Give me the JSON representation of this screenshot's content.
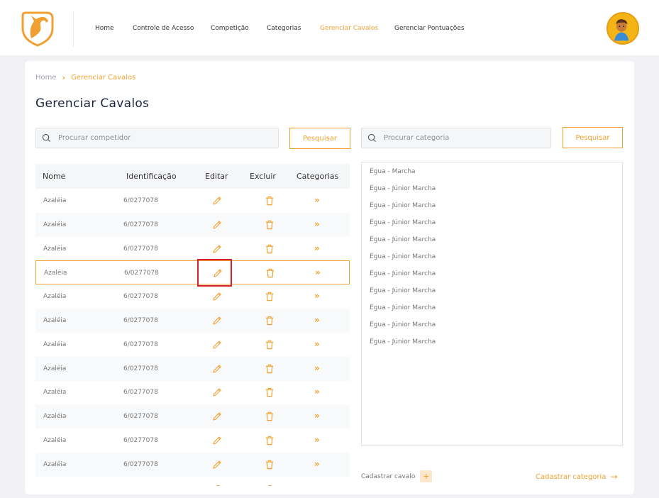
{
  "nav": {
    "items": [
      "Home",
      "Controle de Acesso",
      "Competição",
      "Categorias",
      "Gerenciar Cavalos",
      "Gerenciar Pontuações"
    ],
    "active_index": 4
  },
  "breadcrumb": {
    "home": "Home",
    "separator": "›",
    "current": "Gerenciar Cavalos"
  },
  "page_title": "Gerenciar Cavalos",
  "search_competitor": {
    "placeholder": "Procurar competidor",
    "button": "Pesquisar"
  },
  "search_category": {
    "placeholder": "Procurar categoria",
    "button": "Pesquisar"
  },
  "table": {
    "headers": [
      "Nome",
      "Identificação",
      "Editar",
      "Excluir",
      "Categorias"
    ],
    "rows": [
      {
        "name": "Azaléia",
        "id": "6/0277078"
      },
      {
        "name": "Azaléia",
        "id": "6/0277078"
      },
      {
        "name": "Azaléia",
        "id": "6/0277078"
      },
      {
        "name": "Azaléia",
        "id": "6/0277078"
      },
      {
        "name": "Azaléia",
        "id": "6/0277078"
      },
      {
        "name": "Azaléia",
        "id": "6/0277078"
      },
      {
        "name": "Azaléia",
        "id": "6/0277078"
      },
      {
        "name": "Azaléia",
        "id": "6/0277078"
      },
      {
        "name": "Azaléia",
        "id": "6/0277078"
      },
      {
        "name": "Azaléia",
        "id": "6/0277078"
      },
      {
        "name": "Azaléia",
        "id": "6/0277078"
      },
      {
        "name": "Azaléia",
        "id": "6/0277078"
      }
    ],
    "selected_row": 3,
    "categories_glyph": "»"
  },
  "categories": [
    "Égua - Marcha",
    "Égua - Júnior Marcha",
    "Égua - Júnior Marcha",
    "Égua - Júnior Marcha",
    "Égua - Júnior Marcha",
    "Égua - Júnior Marcha",
    "Égua - Júnior Marcha",
    "Égua - Júnior Marcha",
    "Égua - Júnior Marcha",
    "Égua - Júnior Marcha",
    "Égua - Júnior Marcha"
  ],
  "footer": {
    "register_horse": "Cadastrar cavalo",
    "plus": "+",
    "register_category": "Cadastrar categoria",
    "arrow": "→"
  },
  "colors": {
    "accent": "#f0a030",
    "title": "#1c2340",
    "highlight": "#d8202a"
  },
  "icons": [
    "logo-horse-icon",
    "avatar-icon",
    "search-icon",
    "pencil-icon",
    "trash-icon",
    "double-chevron-right-icon",
    "plus-icon",
    "arrow-right-icon"
  ]
}
